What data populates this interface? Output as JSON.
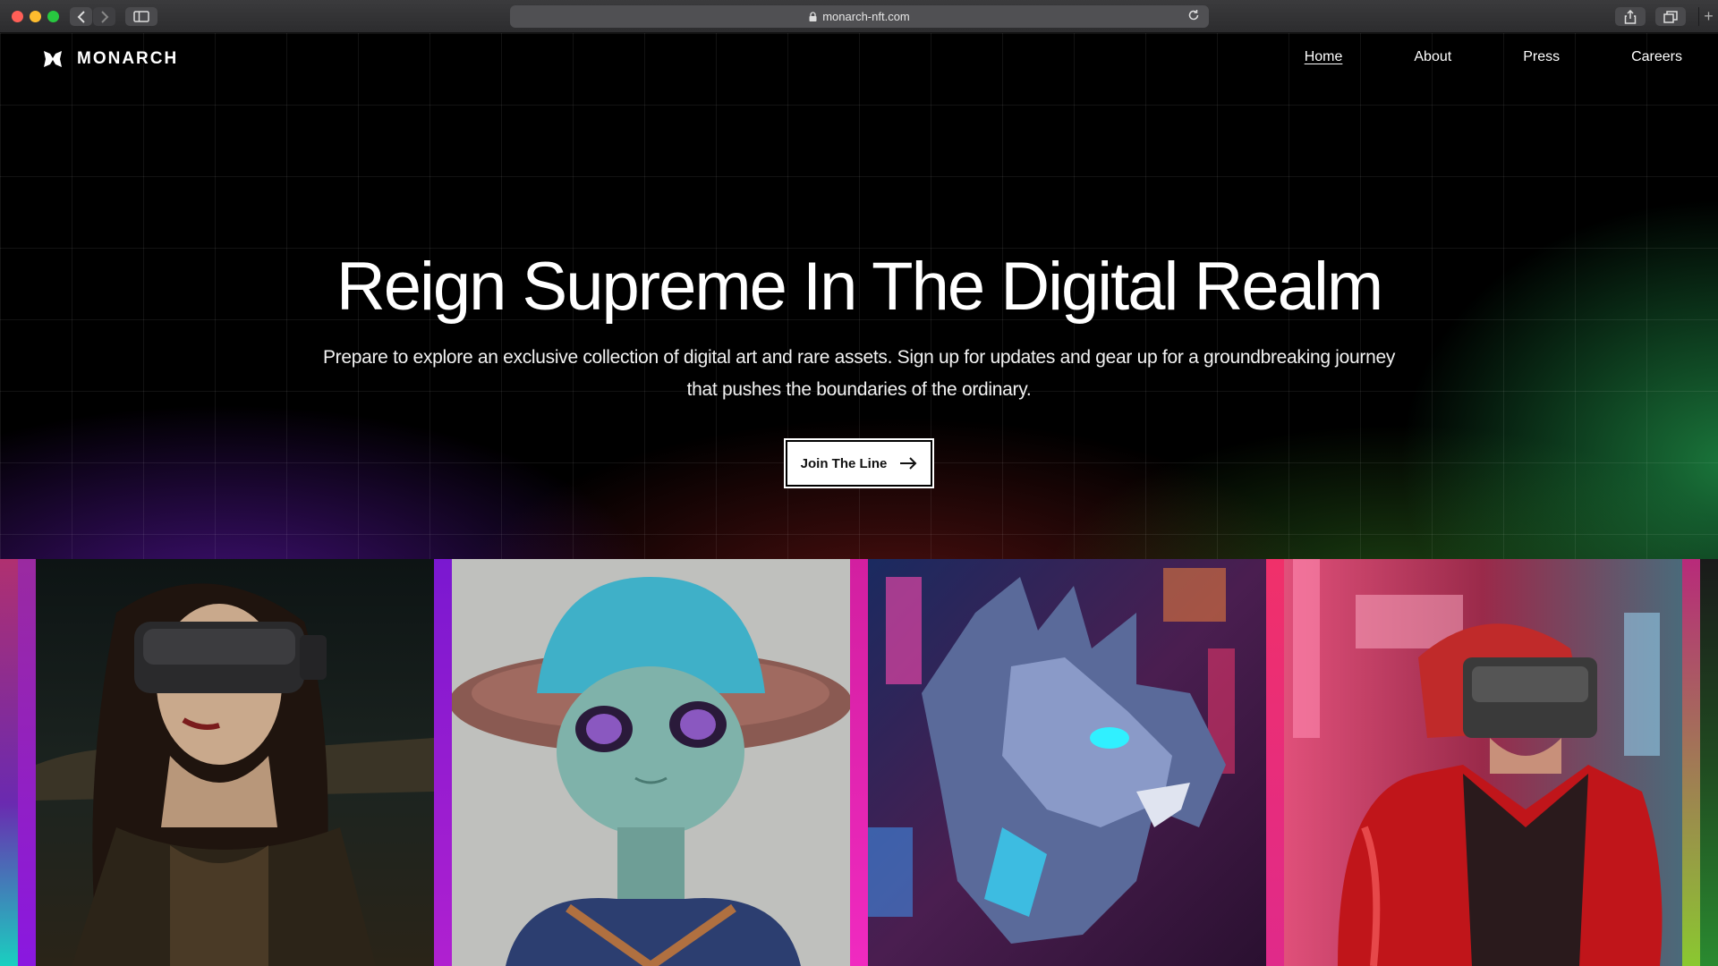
{
  "browser": {
    "url": "monarch-nft.com"
  },
  "brand": {
    "name": "MONARCH",
    "icon": "monarch-logo-icon"
  },
  "nav": {
    "items": [
      {
        "label": "Home",
        "active": true
      },
      {
        "label": "About",
        "active": false
      },
      {
        "label": "Press",
        "active": false
      },
      {
        "label": "Careers",
        "active": false
      }
    ]
  },
  "hero": {
    "title": "Reign Supreme In The Digital Realm",
    "subtitle": "Prepare to explore an exclusive collection of digital art and rare assets. Sign up for updates and gear up for a groundbreaking journey that pushes the boundaries of the ordinary.",
    "cta_label": "Join The Line"
  },
  "gallery": {
    "cards": [
      {
        "icon": "vr-woman-portrait-image"
      },
      {
        "icon": "alien-with-hat-image"
      },
      {
        "icon": "cyber-dragon-image"
      },
      {
        "icon": "red-jacket-vr-girl-image"
      }
    ]
  },
  "colors": {
    "accent_purple": "#7a2ee0",
    "accent_magenta": "#d21fa0",
    "accent_green": "#2cb45a"
  }
}
